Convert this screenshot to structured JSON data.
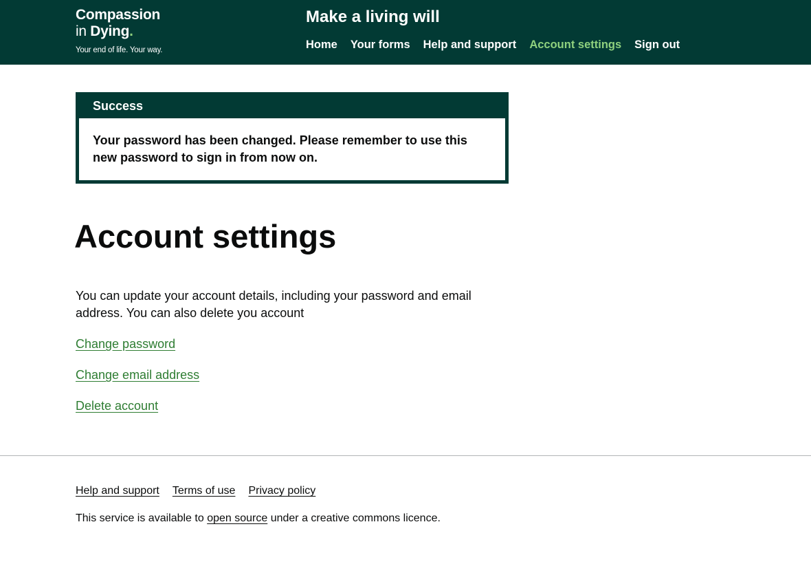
{
  "header": {
    "logo": {
      "line1": "Compassion",
      "line2_prefix": "in ",
      "line2_strong": "Dying",
      "line2_dot": ".",
      "tagline": "Your end of life. Your way."
    },
    "service_name": "Make a living will",
    "nav": {
      "home": "Home",
      "your_forms": "Your forms",
      "help_and_support": "Help and support",
      "account_settings": "Account settings",
      "sign_out": "Sign out"
    }
  },
  "banner": {
    "title": "Success",
    "message": "Your password has been changed. Please remember to use this new password to sign in from now on."
  },
  "main": {
    "title": "Account settings",
    "intro": "You can update your account details, including your password and email address. You can also delete you account",
    "links": {
      "change_password": "Change password",
      "change_email": "Change email address",
      "delete_account": "Delete account"
    }
  },
  "footer": {
    "links": {
      "help_and_support": "Help and support",
      "terms_of_use": "Terms of use",
      "privacy_policy": "Privacy policy"
    },
    "licence": {
      "prefix": "This service is available to ",
      "link": "open source",
      "suffix": " under a creative commons licence."
    }
  },
  "colors": {
    "header_background": "#023a34",
    "active_nav": "#8fd17e",
    "link": "#2e7d32"
  }
}
